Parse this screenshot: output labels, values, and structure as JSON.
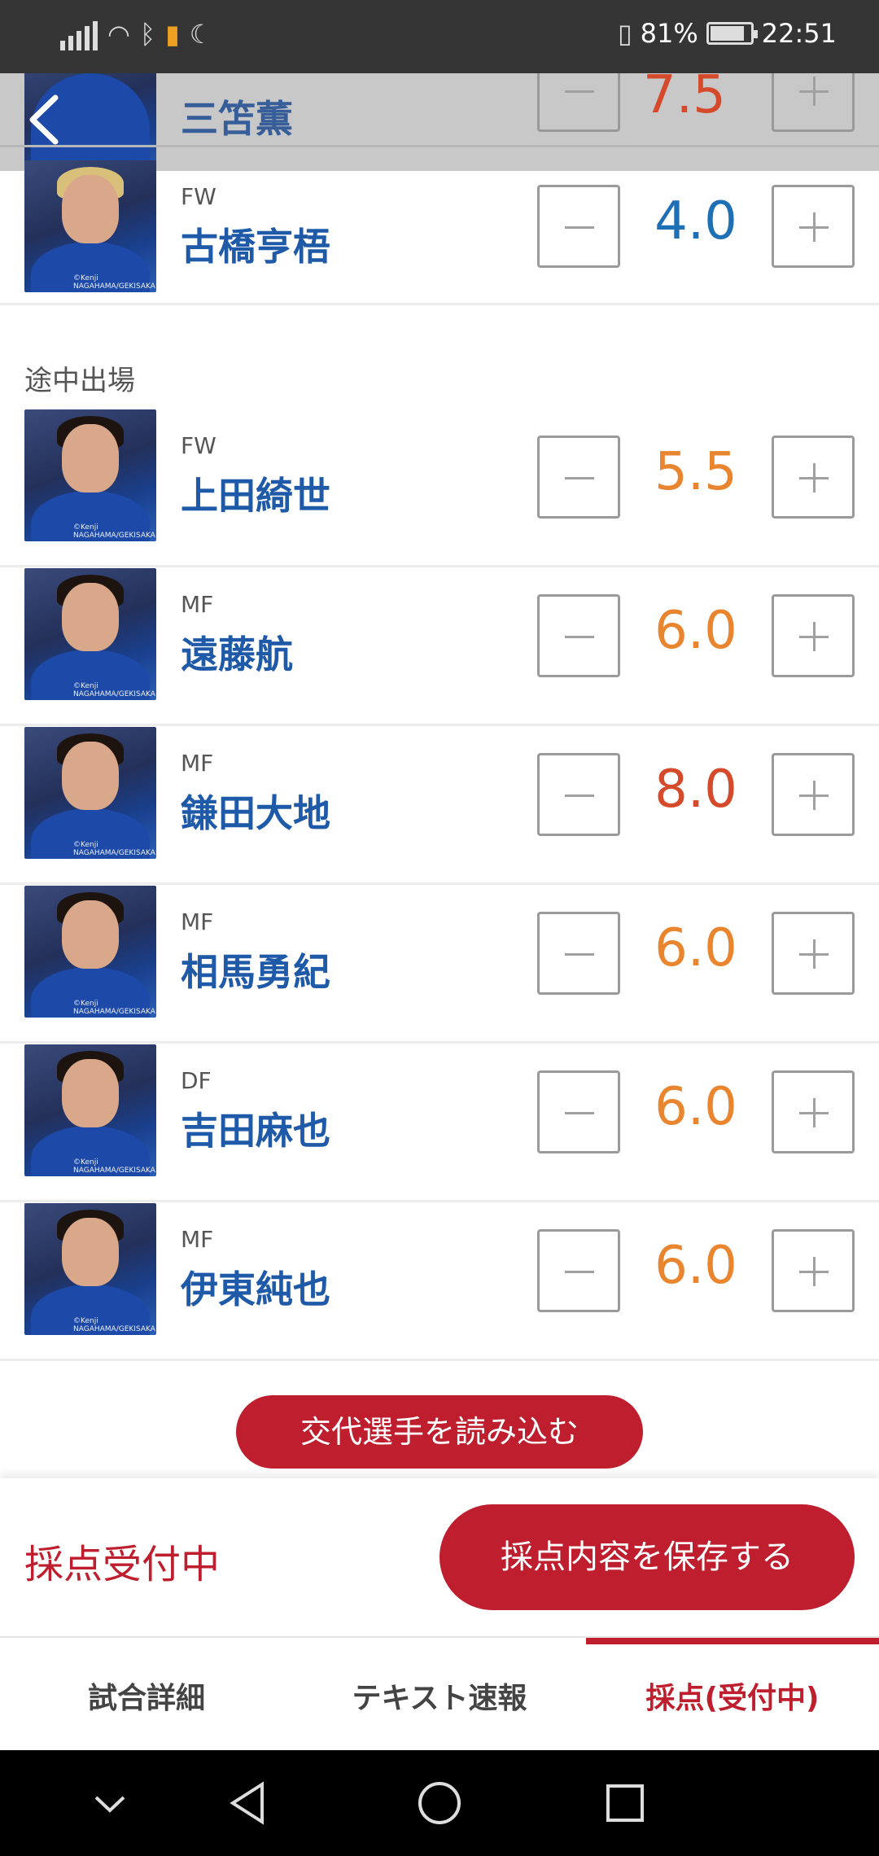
{
  "status_bar": {
    "battery": "81%",
    "time": "22:51"
  },
  "overlay_row": {
    "name": "三笘薫",
    "score": "7.5"
  },
  "starters_tail": [
    {
      "position": "FW",
      "name": "古橋亨梧",
      "score": "4.0",
      "score_color": "#1f6fb5",
      "hair": "blond"
    }
  ],
  "section_label": "途中出場",
  "substitutes": [
    {
      "position": "FW",
      "name": "上田綺世",
      "score": "5.5",
      "score_color": "#e8852e"
    },
    {
      "position": "MF",
      "name": "遠藤航",
      "score": "6.0",
      "score_color": "#e8852e"
    },
    {
      "position": "MF",
      "name": "鎌田大地",
      "score": "8.0",
      "score_color": "#d44a2a"
    },
    {
      "position": "MF",
      "name": "相馬勇紀",
      "score": "6.0",
      "score_color": "#e8852e"
    },
    {
      "position": "DF",
      "name": "吉田麻也",
      "score": "6.0",
      "score_color": "#e8852e"
    },
    {
      "position": "MF",
      "name": "伊東純也",
      "score": "6.0",
      "score_color": "#e8852e"
    }
  ],
  "photo_credit": "©Kenji NAGAHAMA/GEKISAKA",
  "load_button": "交代選手を読み込む",
  "action": {
    "status": "採点受付中",
    "save_label": "採点内容を保存する"
  },
  "tabs": [
    {
      "label": "試合詳細"
    },
    {
      "label": "テキスト速報"
    },
    {
      "label": "採点(受付中)",
      "active": true
    }
  ]
}
